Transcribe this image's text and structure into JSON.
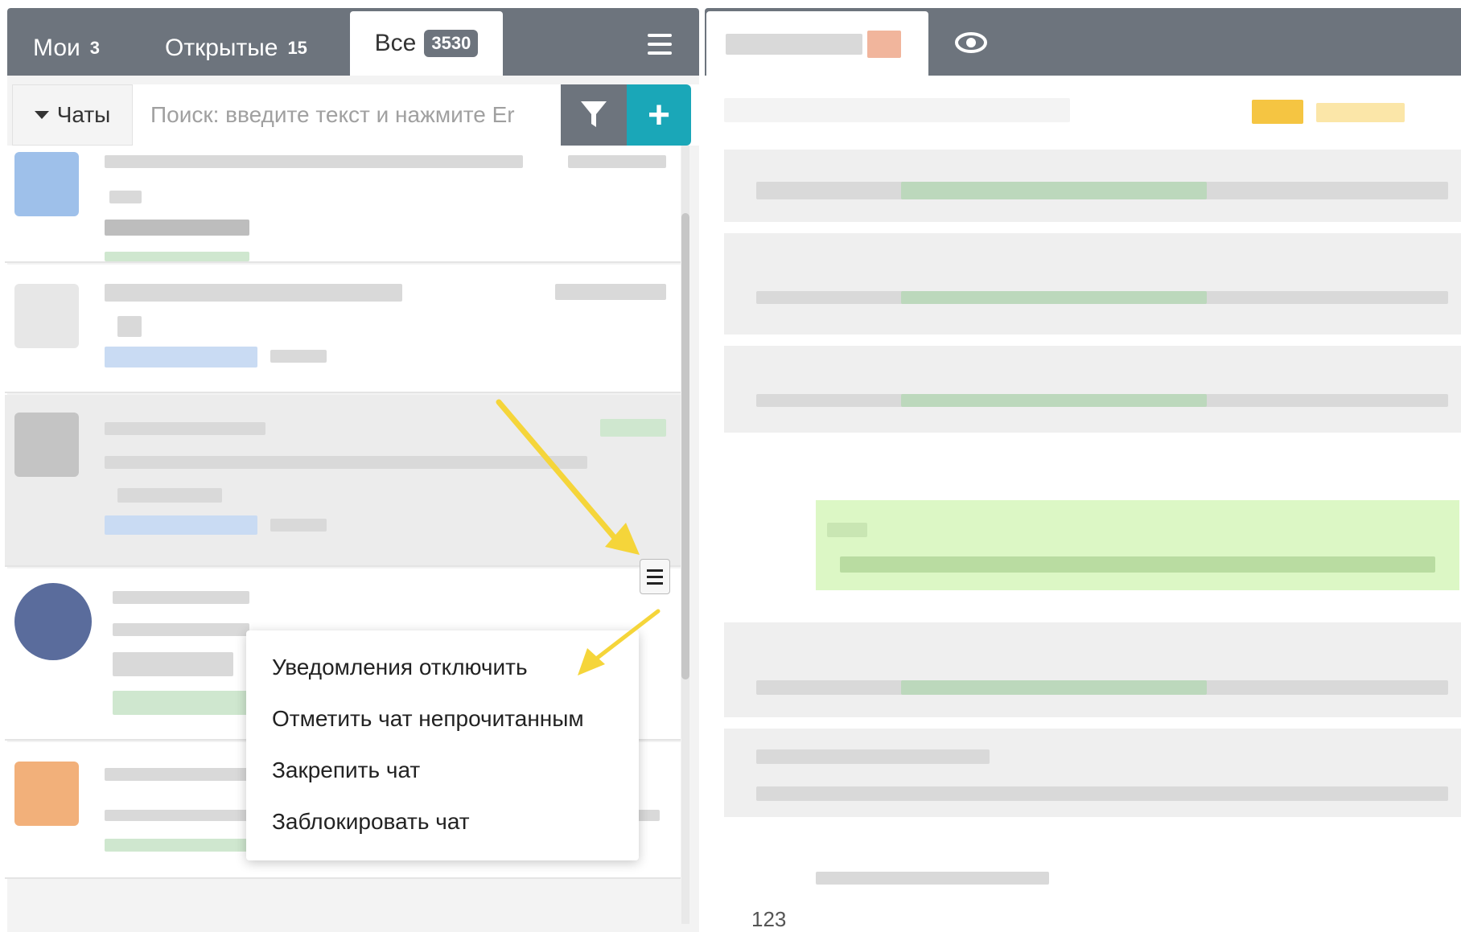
{
  "tabs": {
    "mine": {
      "label": "Мои",
      "count": "3"
    },
    "open": {
      "label": "Открытые",
      "count": "15"
    },
    "all": {
      "label": "Все",
      "count": "3530"
    }
  },
  "search": {
    "dropdown_label": "Чаты",
    "placeholder": "Поиск: введите текст и нажмите Er"
  },
  "context_menu": {
    "items": [
      "Уведомления отключить",
      "Отметить чат непрочитанным",
      "Закрепить чат",
      "Заблокировать чат"
    ]
  },
  "conversation": {
    "page_number": "123"
  },
  "colors": {
    "header_bg": "#6d747d",
    "accent": "#1aa7b8",
    "annotation_arrow": "#f5d53a",
    "outgoing_bubble": "#dcf7c5"
  },
  "icons": [
    "menu-icon",
    "filter-icon",
    "plus-icon",
    "caret-down-icon",
    "eye-icon",
    "row-menu-icon"
  ]
}
